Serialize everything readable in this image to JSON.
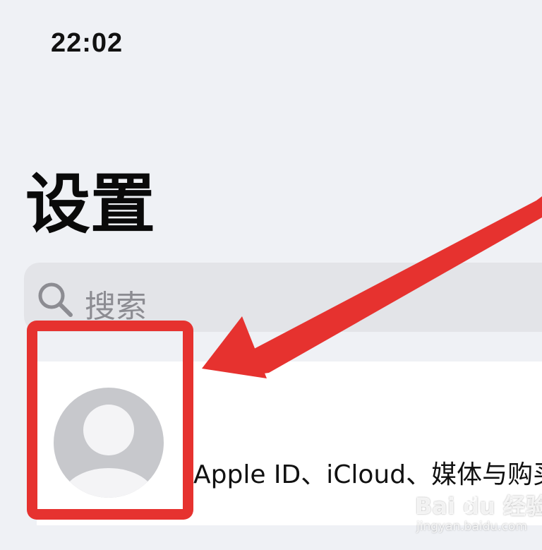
{
  "status_bar": {
    "time": "22:02"
  },
  "header": {
    "title": "设置"
  },
  "search": {
    "placeholder": "搜索",
    "icon": "search-icon"
  },
  "profile": {
    "avatar_icon": "person-avatar-icon",
    "subtitle": "Apple ID、iCloud、媒体与购买"
  },
  "annotation": {
    "highlight_color": "#e6322f",
    "arrow_color": "#e6322f"
  },
  "watermark": {
    "brand": "Bai du 经验",
    "url": "jingyan.baidu.com"
  },
  "colors": {
    "background": "#eff1f5",
    "search_bg": "#e3e4e8",
    "card_bg": "#ffffff",
    "avatar_gray": "#c7c8cc",
    "placeholder_gray": "#8c8c92"
  }
}
